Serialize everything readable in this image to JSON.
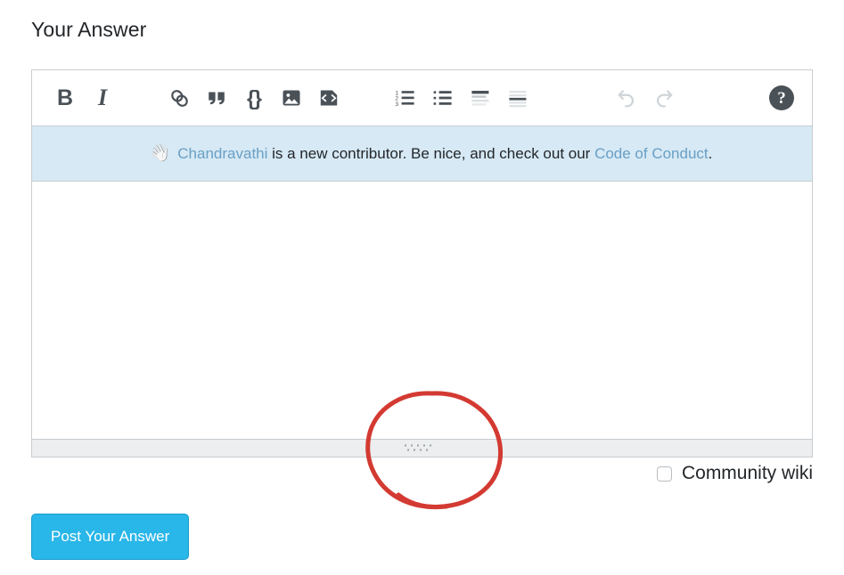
{
  "page": {
    "title": "Your Answer"
  },
  "toolbar": {
    "items": [
      {
        "name": "bold-icon",
        "label": "B",
        "title": "Bold",
        "disabled": false
      },
      {
        "name": "italic-icon",
        "label": "I",
        "title": "Italic",
        "disabled": false
      },
      {
        "name": "link-icon",
        "label": "",
        "title": "Hyperlink",
        "disabled": false
      },
      {
        "name": "blockquote-icon",
        "label": "",
        "title": "Blockquote",
        "disabled": false
      },
      {
        "name": "inline-code-icon",
        "label": "{}",
        "title": "Inline code",
        "disabled": false
      },
      {
        "name": "image-icon",
        "label": "",
        "title": "Image",
        "disabled": false
      },
      {
        "name": "code-snippet-icon",
        "label": "",
        "title": "Code snippet",
        "disabled": false
      },
      {
        "name": "numbered-list-icon",
        "label": "",
        "title": "Numbered list",
        "disabled": false
      },
      {
        "name": "bulleted-list-icon",
        "label": "",
        "title": "Bulleted list",
        "disabled": false
      },
      {
        "name": "heading-icon",
        "label": "",
        "title": "Heading",
        "disabled": false
      },
      {
        "name": "horizontal-rule-icon",
        "label": "",
        "title": "Horizontal rule",
        "disabled": false
      },
      {
        "name": "undo-icon",
        "label": "",
        "title": "Undo",
        "disabled": true
      },
      {
        "name": "redo-icon",
        "label": "",
        "title": "Redo",
        "disabled": true
      }
    ],
    "help_label": "?",
    "help_title": "Help"
  },
  "notice": {
    "emoji": "👋",
    "user_name": "Chandravathi",
    "text_middle": " is a new contributor. Be nice, and check out our ",
    "link_text": "Code of Conduct",
    "text_end": "."
  },
  "answer_field": {
    "value": "",
    "placeholder": ""
  },
  "resize_grip": {
    "name": "resize-grip"
  },
  "community_wiki": {
    "label": "Community wiki",
    "checked": false
  },
  "post_button": {
    "label": "Post Your Answer"
  },
  "annotation": {
    "shape": "hand-drawn-circle",
    "color": "#d33a32"
  },
  "colors": {
    "accent_button": "#29b6e8",
    "notice_background": "#d6e9f5",
    "link": "#6a9fc4",
    "icon": "#4a5157",
    "icon_disabled": "#cfd4d8",
    "border": "#c8ccd0",
    "grip_bar": "#eceeef",
    "annotation": "#d33a32"
  }
}
